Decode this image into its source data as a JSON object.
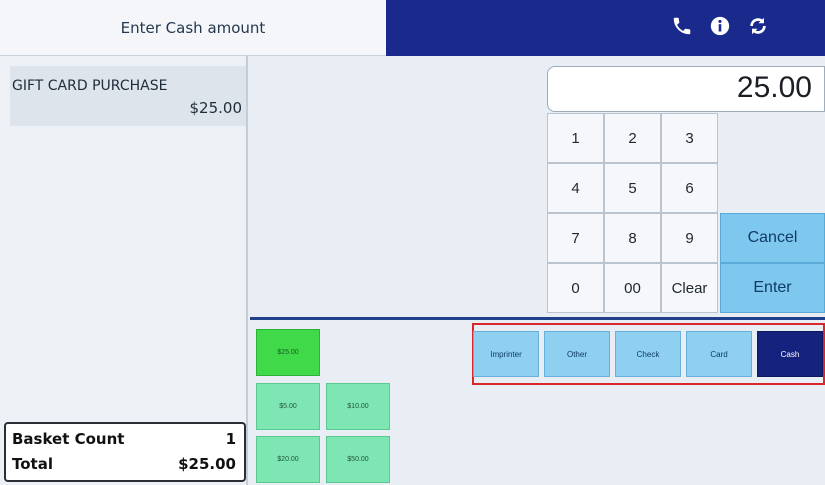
{
  "header": {
    "prompt": "Enter Cash amount",
    "icons": [
      "phone-icon",
      "info-icon",
      "refresh-icon"
    ],
    "accent_color": "#1a2a8c"
  },
  "basket": {
    "items": [
      {
        "name": "GIFT CARD PURCHASE",
        "price": "$25.00"
      }
    ],
    "count_label": "Basket Count",
    "count_value": "1",
    "total_label": "Total",
    "total_value": "$25.00"
  },
  "amount_display": "25.00",
  "keypad": {
    "keys": [
      "1",
      "2",
      "3",
      "4",
      "5",
      "6",
      "7",
      "8",
      "9",
      "0",
      "00",
      "Clear"
    ],
    "cancel_label": "Cancel",
    "enter_label": "Enter"
  },
  "tenders": {
    "labels": [
      "Imprinter",
      "Other",
      "Check",
      "Card",
      "Cash"
    ],
    "active": "Cash"
  },
  "quick_cash": {
    "labels": [
      "$25.00",
      "$5.00",
      "$10.00",
      "$20.00",
      "$50.00"
    ],
    "selected": "$25.00"
  }
}
